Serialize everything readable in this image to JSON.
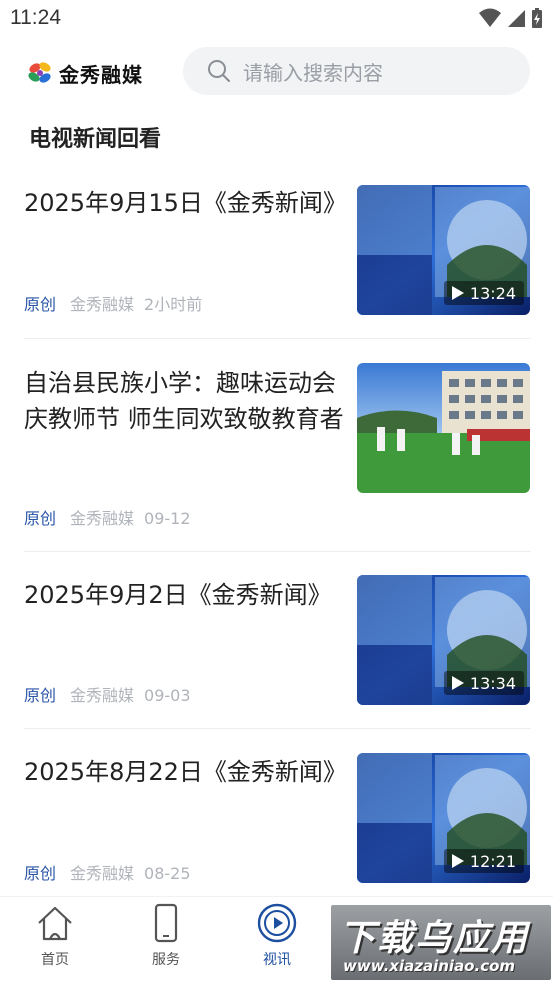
{
  "status_bar": {
    "time": "11:24"
  },
  "header": {
    "logo_text": "金秀融媒",
    "search_placeholder": "请输入搜索内容"
  },
  "section": {
    "title": "电视新闻回看"
  },
  "news": [
    {
      "title": "2025年9月15日《金秀新闻》",
      "tag": "原创",
      "source": "金秀融媒",
      "time": "2小时前",
      "duration": "13:24",
      "thumb_type": "video"
    },
    {
      "title": "自治县民族小学：趣味运动会庆教师节 师生同欢致敬教育者",
      "tag": "原创",
      "source": "金秀融媒",
      "time": "09-12",
      "duration": "",
      "thumb_type": "photo"
    },
    {
      "title": "2025年9月2日《金秀新闻》",
      "tag": "原创",
      "source": "金秀融媒",
      "time": "09-03",
      "duration": "13:34",
      "thumb_type": "video"
    },
    {
      "title": "2025年8月22日《金秀新闻》",
      "tag": "原创",
      "source": "金秀融媒",
      "time": "08-25",
      "duration": "12:21",
      "thumb_type": "video"
    }
  ],
  "tabbar": {
    "tabs": [
      {
        "label": "首页",
        "icon": "home-icon",
        "active": false
      },
      {
        "label": "服务",
        "icon": "phone-icon",
        "active": false
      },
      {
        "label": "视讯",
        "icon": "play-circle-icon",
        "active": true
      }
    ]
  },
  "watermark": {
    "main": "下载乌应用",
    "sub": "www.xiazainiao.com"
  },
  "colors": {
    "accent": "#1c4fa0",
    "tag": "#2a56a8",
    "meta": "#b0b4ba"
  }
}
